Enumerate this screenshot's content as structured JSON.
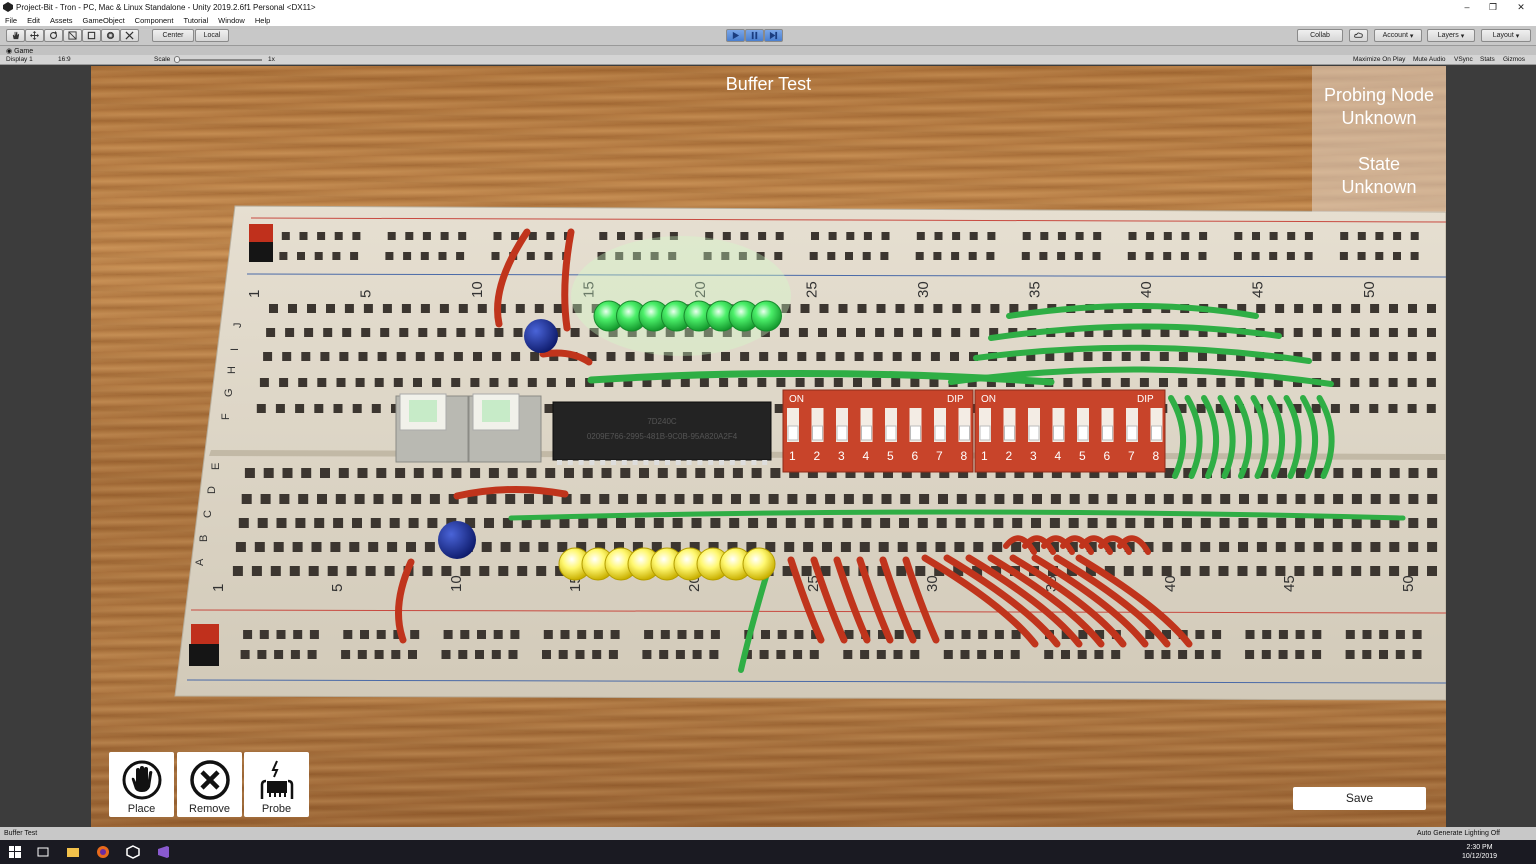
{
  "window": {
    "title": "Project-Bit - Tron - PC, Mac & Linux Standalone - Unity 2019.2.6f1 Personal <DX11>",
    "minimize": "–",
    "maximize": "❐",
    "close": "✕"
  },
  "menu": [
    "File",
    "Edit",
    "Assets",
    "GameObject",
    "Component",
    "Tutorial",
    "Window",
    "Help"
  ],
  "toolbar": {
    "pivot_label": "Center",
    "space_label": "Local",
    "collab_label": "Collab",
    "account_label": "Account",
    "layers_label": "Layers",
    "layout_label": "Layout"
  },
  "game_tab": {
    "label": "Game"
  },
  "game_bar": {
    "display": "Display 1",
    "aspect": "16:9",
    "scale_label": "Scale",
    "scale_value": "1x",
    "maximize_on_play": "Maximize On Play",
    "mute_audio": "Mute Audio",
    "vsync": "VSync",
    "stats": "Stats",
    "gizmos": "Gizmos"
  },
  "scene": {
    "title": "Buffer Test",
    "probe_node_label": "Probing Node",
    "probe_node_value": "Unknown",
    "state_label": "State",
    "state_value": "Unknown"
  },
  "board": {
    "top_numbers": [
      "1",
      "5",
      "10",
      "15",
      "20",
      "25",
      "30",
      "35",
      "40",
      "45",
      "50"
    ],
    "bottom_numbers": [
      "1",
      "5",
      "10",
      "15",
      "20",
      "25",
      "30",
      "35",
      "40",
      "45",
      "50"
    ],
    "row_letters_top": [
      "J",
      "I",
      "H",
      "G",
      "F"
    ],
    "row_letters_bottom": [
      "E",
      "D",
      "C",
      "B",
      "A"
    ],
    "chip_label": "7D240C",
    "chip_code": "0209E766-2995-481B-9C0B-95A820A2F4",
    "dip1": {
      "on": "ON",
      "dip": "DIP",
      "numbers": [
        "1",
        "2",
        "3",
        "4",
        "5",
        "6",
        "7",
        "8"
      ]
    },
    "dip2": {
      "on": "ON",
      "dip": "DIP",
      "numbers": [
        "1",
        "2",
        "3",
        "4",
        "5",
        "6",
        "7",
        "8"
      ]
    }
  },
  "buttons": {
    "place": "Place",
    "remove": "Remove",
    "probe": "Probe",
    "save": "Save"
  },
  "status_bar": {
    "left": "Buffer Test",
    "right": "Auto Generate Lighting Off"
  },
  "taskbar": {
    "time": "2:30 PM",
    "date": "10/12/2019"
  },
  "colors": {
    "wire_red": "#c0341c",
    "wire_green": "#2fae45",
    "led_green": "#3be25a",
    "led_yellow": "#fff45a",
    "dip_red": "#c8442a"
  }
}
